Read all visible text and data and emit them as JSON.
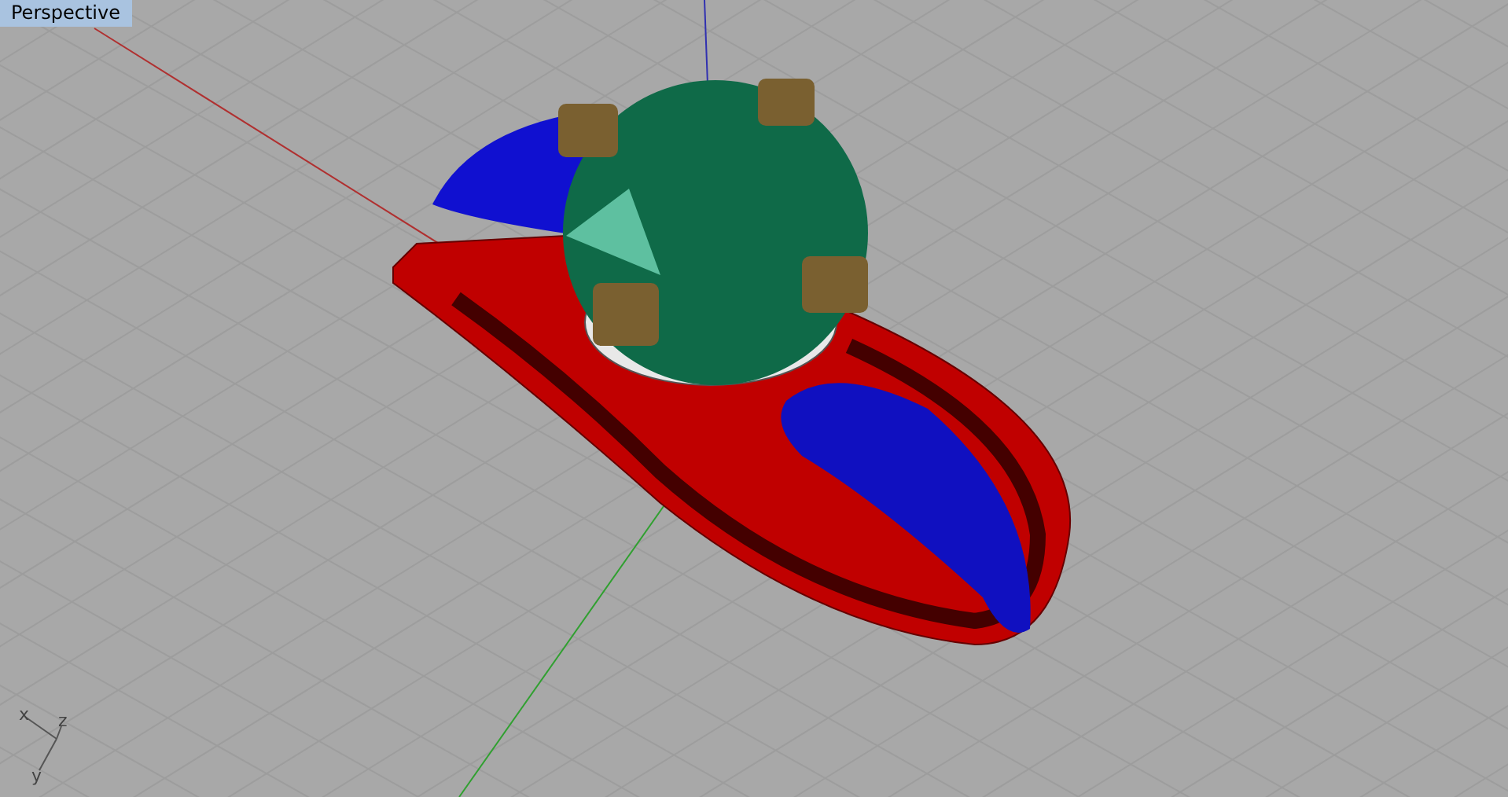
{
  "viewport": {
    "title": "Perspective"
  },
  "axis_icon": {
    "labels": [
      {
        "text": "x"
      },
      {
        "text": "z"
      },
      {
        "text": "y"
      }
    ]
  }
}
